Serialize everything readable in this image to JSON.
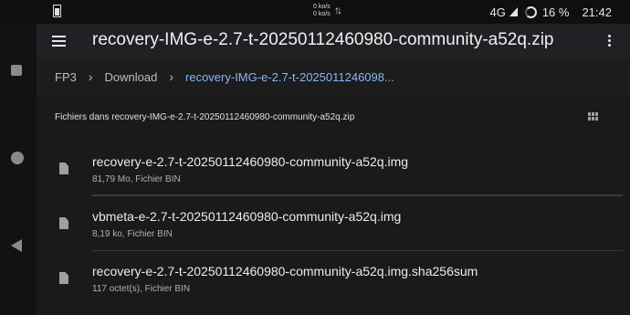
{
  "status_bar": {
    "speed_up": "0 ko/s",
    "speed_down": "0 ko/s",
    "network": "4G",
    "battery_pct": "16 %",
    "time": "21:42"
  },
  "app_bar": {
    "title": "recovery-IMG-e-2.7-t-20250112460980-community-a52q.zip"
  },
  "breadcrumb": {
    "items": [
      {
        "label": "FP3"
      },
      {
        "label": "Download"
      },
      {
        "label": "recovery-IMG-e-2.7-t-2025011246098..."
      }
    ]
  },
  "list_header": {
    "title": "Fichiers dans recovery-IMG-e-2.7-t-20250112460980-community-a52q.zip"
  },
  "files": [
    {
      "name": "recovery-e-2.7-t-20250112460980-community-a52q.img",
      "meta": "81,79 Mo, Fichier BIN"
    },
    {
      "name": "vbmeta-e-2.7-t-20250112460980-community-a52q.img",
      "meta": "8,19 ko, Fichier BIN"
    },
    {
      "name": "recovery-e-2.7-t-20250112460980-community-a52q.img.sha256sum",
      "meta": "117 octet(s), Fichier BIN"
    }
  ]
}
